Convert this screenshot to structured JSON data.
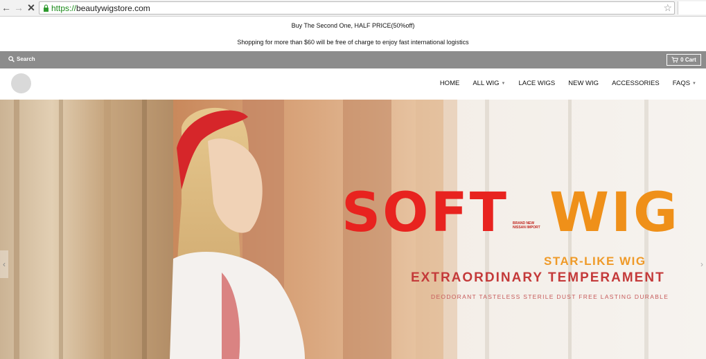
{
  "browser": {
    "url_scheme": "https://",
    "url_host": "beautywigstore.com"
  },
  "announcement": {
    "line1": "Buy The Second One, HALF PRICE(50%off)",
    "line2": "Shopping for more than $60 will be free of charge to enjoy fast international logistics"
  },
  "utility": {
    "search_label": "Search",
    "cart_label": "0 Cart"
  },
  "nav": {
    "items": [
      {
        "label": "HOME",
        "dropdown": false
      },
      {
        "label": "ALL WIG",
        "dropdown": true
      },
      {
        "label": "LACE WIGS",
        "dropdown": false
      },
      {
        "label": "NEW WIG",
        "dropdown": false
      },
      {
        "label": "ACCESSORIES",
        "dropdown": false
      },
      {
        "label": "FAQS",
        "dropdown": true
      }
    ]
  },
  "hero": {
    "headline_soft": "SOFT",
    "headline_wig": "WIG",
    "small_tag": "BRAND NEW NISSAN IMPORT",
    "tagline_1": "STAR-LIKE WIG",
    "tagline_2": "EXTRAORDINARY TEMPERAMENT",
    "features": "DEODORANT  TASTELESS  STERILE  DUST FREE  LASTING  DURABLE",
    "prev_arrow": "‹",
    "next_arrow": "›"
  },
  "colors": {
    "utility_bar": "#8c8c8c",
    "headline_red": "#e8231f",
    "headline_orange": "#ef9019",
    "tagline_orange": "#ef9a28",
    "tagline_red": "#c43a3a"
  }
}
